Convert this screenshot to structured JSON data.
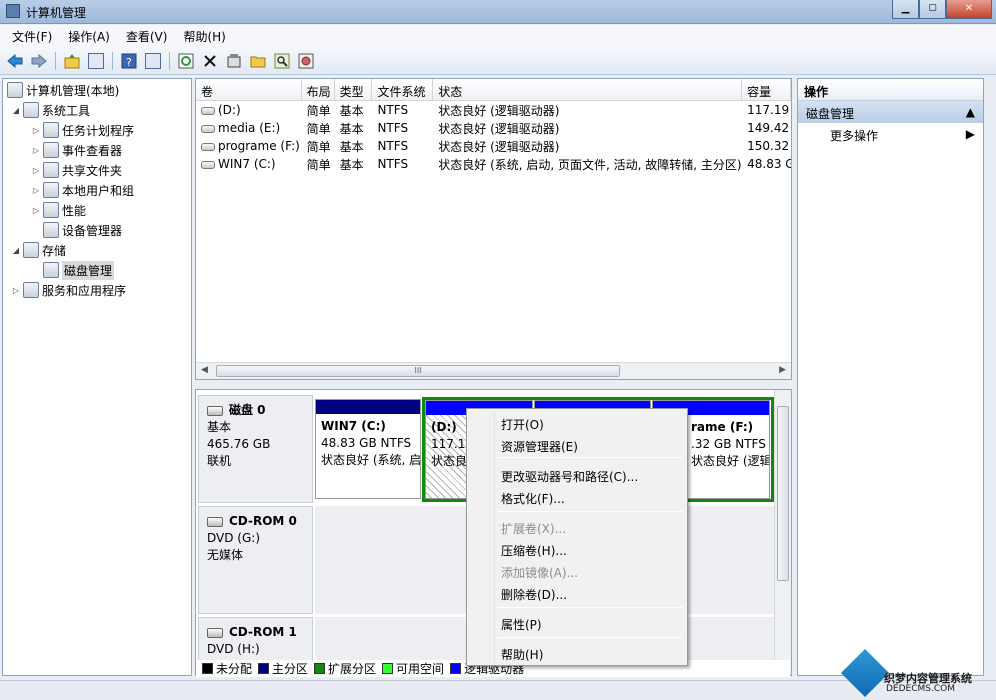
{
  "window": {
    "title": "计算机管理"
  },
  "menu": [
    "文件(F)",
    "操作(A)",
    "查看(V)",
    "帮助(H)"
  ],
  "tree": [
    {
      "label": "计算机管理(本地)",
      "depth": 0,
      "expander": ""
    },
    {
      "label": "系统工具",
      "depth": 1,
      "expander": "◢"
    },
    {
      "label": "任务计划程序",
      "depth": 2,
      "expander": "▷"
    },
    {
      "label": "事件查看器",
      "depth": 2,
      "expander": "▷"
    },
    {
      "label": "共享文件夹",
      "depth": 2,
      "expander": "▷"
    },
    {
      "label": "本地用户和组",
      "depth": 2,
      "expander": "▷"
    },
    {
      "label": "性能",
      "depth": 2,
      "expander": "▷"
    },
    {
      "label": "设备管理器",
      "depth": 2,
      "expander": ""
    },
    {
      "label": "存储",
      "depth": 1,
      "expander": "◢"
    },
    {
      "label": "磁盘管理",
      "depth": 2,
      "expander": "",
      "selected": true
    },
    {
      "label": "服务和应用程序",
      "depth": 1,
      "expander": "▷"
    }
  ],
  "volumes": {
    "headers": [
      "卷",
      "布局",
      "类型",
      "文件系统",
      "状态",
      "容量"
    ],
    "rows": [
      [
        "(D:)",
        "简单",
        "基本",
        "NTFS",
        "状态良好 (逻辑驱动器)",
        "117.19"
      ],
      [
        "media (E:)",
        "简单",
        "基本",
        "NTFS",
        "状态良好 (逻辑驱动器)",
        "149.42"
      ],
      [
        "programe (F:)",
        "简单",
        "基本",
        "NTFS",
        "状态良好 (逻辑驱动器)",
        "150.32"
      ],
      [
        "WIN7 (C:)",
        "简单",
        "基本",
        "NTFS",
        "状态良好 (系统, 启动, 页面文件, 活动, 故障转储, 主分区)",
        "48.83 G"
      ]
    ]
  },
  "disks": [
    {
      "name": "磁盘 0",
      "type": "基本",
      "size": "465.76 GB",
      "status": "联机"
    },
    {
      "name": "CD-ROM 0",
      "type": "DVD (G:)",
      "size": "",
      "status": "无媒体"
    },
    {
      "name": "CD-ROM 1",
      "type": "DVD (H:)",
      "size": "",
      "status": ""
    }
  ],
  "partitions": {
    "c": {
      "name": "WIN7  (C:)",
      "size": "48.83 GB NTFS",
      "status": "状态良好 (系统, 启"
    },
    "d": {
      "name": "(D:)",
      "size": "117.19",
      "status": "状态良"
    },
    "f": {
      "name": "rame  (F:)",
      "size": ".32 GB NTFS",
      "status": "状态良好 (逻辑驱"
    }
  },
  "legend": [
    {
      "label": "未分配",
      "color": "#000000"
    },
    {
      "label": "主分区",
      "color": "#000080"
    },
    {
      "label": "扩展分区",
      "color": "#0f8a0f"
    },
    {
      "label": "可用空间",
      "color": "#33ff33"
    },
    {
      "label": "逻辑驱动器",
      "color": "#0000ff"
    }
  ],
  "actions": {
    "title": "操作",
    "section": "磁盘管理",
    "more": "更多操作"
  },
  "context_menu": [
    {
      "label": "打开(O)",
      "enabled": true
    },
    {
      "label": "资源管理器(E)",
      "enabled": true
    },
    {
      "sep": true
    },
    {
      "label": "更改驱动器号和路径(C)...",
      "enabled": true
    },
    {
      "label": "格式化(F)...",
      "enabled": true
    },
    {
      "sep": true
    },
    {
      "label": "扩展卷(X)...",
      "enabled": false
    },
    {
      "label": "压缩卷(H)...",
      "enabled": true
    },
    {
      "label": "添加镜像(A)...",
      "enabled": false
    },
    {
      "label": "删除卷(D)...",
      "enabled": true
    },
    {
      "sep": true
    },
    {
      "label": "属性(P)",
      "enabled": true
    },
    {
      "sep": true
    },
    {
      "label": "帮助(H)",
      "enabled": true
    }
  ],
  "watermark": {
    "brand": "织梦内容管理系统",
    "url": "DEDECMS.COM"
  },
  "colors": {
    "primary_partition": "#000080",
    "logical_drive": "#0000ff",
    "extended_partition": "#0f8a0f"
  }
}
